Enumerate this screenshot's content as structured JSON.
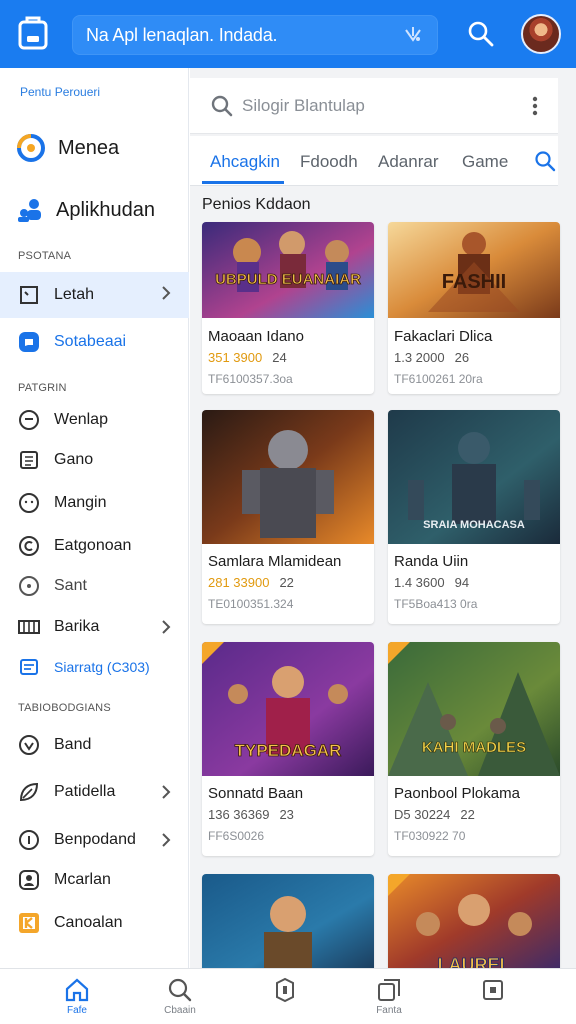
{
  "topbar": {
    "search_text": "Na Apl lenaqlan. Indada.",
    "icons": {
      "app": "app-logo-icon",
      "mic": "mic-icon",
      "search": "search-icon",
      "avatar": "avatar"
    }
  },
  "sidebar": {
    "top_label": "Pentu Peroueri",
    "big_items": [
      {
        "label": "Menea",
        "icon": "menea-logo-icon"
      },
      {
        "label": "Aplikhudan",
        "icon": "people-icon"
      }
    ],
    "sections": [
      "PSOTANA",
      "PATGRIN",
      "TABIOBODGIANS"
    ],
    "items": [
      {
        "label": "Letah",
        "icon": "square-icon",
        "chevron": true,
        "active": true
      },
      {
        "label": "Sotabeaai",
        "icon": "chat-icon",
        "chevron": false,
        "blue": true
      },
      {
        "label": "Wenlap",
        "icon": "face-icon",
        "chevron": false
      },
      {
        "label": "Gano",
        "icon": "list-icon",
        "chevron": false
      },
      {
        "label": "Mangin",
        "icon": "smile-icon",
        "chevron": false
      },
      {
        "label": "Eatgonoan",
        "icon": "circle-c-icon",
        "chevron": false
      },
      {
        "label": "Sant",
        "icon": "circle-icon",
        "chevron": false
      },
      {
        "label": "Barika",
        "icon": "grid-icon",
        "chevron": true
      },
      {
        "label": "Siarratg (C303)",
        "icon": "doc-icon",
        "chevron": false,
        "blue": true
      },
      {
        "label": "Band",
        "icon": "heart-icon",
        "chevron": false
      },
      {
        "label": "Patidella",
        "icon": "leaf-icon",
        "chevron": true
      },
      {
        "label": "Benpodand",
        "icon": "info-icon",
        "chevron": true
      },
      {
        "label": "Mcarlan",
        "icon": "person-icon",
        "chevron": false
      },
      {
        "label": "Canoalan",
        "icon": "k-logo-icon",
        "chevron": false
      }
    ]
  },
  "main": {
    "search_placeholder": "Silogir Blantulap",
    "tabs": [
      "Ahcagkin",
      "Fdoodh",
      "Adanrar",
      "Game"
    ],
    "section_title": "Penios Kddaon",
    "cards": [
      {
        "title": "Maoaan Idano",
        "price": "351 3900",
        "count": "24",
        "sub": "TF6100357.3oa",
        "art_text": "UBPULD EUANAIAR",
        "price_style": "orange"
      },
      {
        "title": "Fakaclari Dlica",
        "price": "1.3 2000",
        "count": "26",
        "sub": "TF6100261 20ra",
        "art_text": "FASHII",
        "price_style": "dark"
      },
      {
        "title": "Samlara Mlamidean",
        "price": "281 33900",
        "count": "22",
        "sub": "TE0100351.324",
        "art_text": "",
        "price_style": "orange"
      },
      {
        "title": "Randa Uiin",
        "price": "1.4 3600",
        "count": "94",
        "sub": "TF5Boa413 0ra",
        "art_text": "SRAIA MOHACASA",
        "price_style": "mixed"
      },
      {
        "title": "Sonnatd Baan",
        "price": "136 36369",
        "count": "23",
        "sub": "FF6S0026",
        "art_text": "TYPEDAGAR",
        "price_style": "dark"
      },
      {
        "title": "Paonbool Plokama",
        "price": "D5 30224",
        "count": "22",
        "sub": "TF030922 70",
        "art_text": "KAHI MADLES",
        "price_style": "dark"
      },
      {
        "title": "",
        "price": "",
        "count": "",
        "sub": "",
        "art_text": "",
        "price_style": "dark"
      },
      {
        "title": "",
        "price": "",
        "count": "",
        "sub": "",
        "art_text": "LAUREL",
        "price_style": "dark"
      }
    ]
  },
  "bottomnav": {
    "items": [
      {
        "label": "Fafe",
        "icon": "home-icon",
        "active": true
      },
      {
        "label": "Cbaain",
        "icon": "search-icon",
        "active": false
      },
      {
        "label": "",
        "icon": "badge-icon",
        "active": false
      },
      {
        "label": "Fanta",
        "icon": "copy-icon",
        "active": false
      },
      {
        "label": "",
        "icon": "box-icon",
        "active": false
      }
    ]
  },
  "colors": {
    "accent": "#1a7cf0",
    "active_tab": "#1a73e8",
    "price_orange": "#e19a10",
    "sidebar_active_bg": "#e5effe"
  }
}
